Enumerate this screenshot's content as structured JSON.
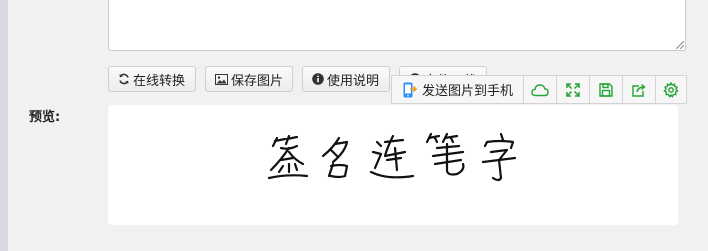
{
  "buttons": {
    "convert": "在线转换",
    "save": "保存图片",
    "help": "使用说明",
    "download": "文件下载"
  },
  "preview": {
    "label": "预览:",
    "signature_text": "签名连笔字"
  },
  "toolbar": {
    "send_label": "发送图片到手机",
    "icons": [
      "cloud-icon",
      "fullscreen-icon",
      "save-disk-icon",
      "share-icon",
      "settings-icon"
    ],
    "accent_color": "#23a435"
  }
}
